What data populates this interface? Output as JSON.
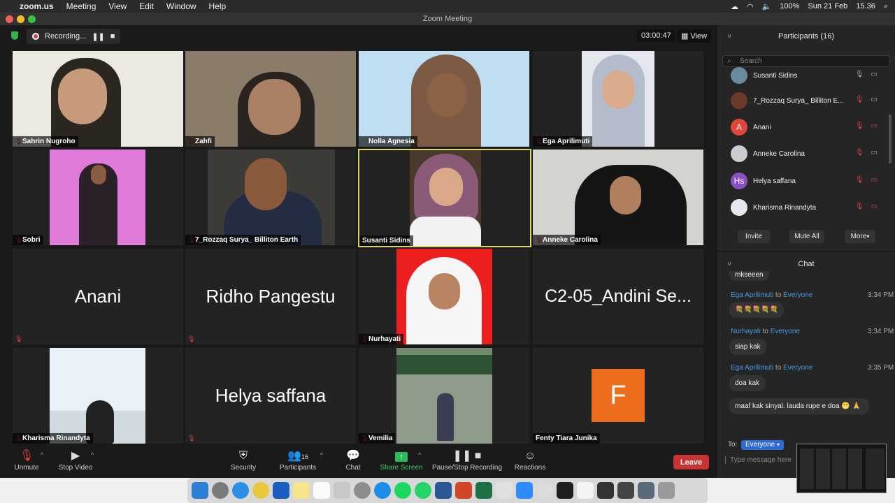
{
  "menubar": {
    "app": "zoom.us",
    "items": [
      "Meeting",
      "View",
      "Edit",
      "Window",
      "Help"
    ],
    "battery": "100%",
    "date": "Sun 21 Feb",
    "time": "15.36"
  },
  "window": {
    "title": "Zoom Meeting"
  },
  "recording": {
    "label": "Recording...",
    "timer": "03:00:47",
    "view": "View"
  },
  "tiles": [
    {
      "name": "Sahrin Nugroho"
    },
    {
      "name": "Zahfi"
    },
    {
      "name": "Nolla Agnesia"
    },
    {
      "name": "Ega Aprilimuti"
    },
    {
      "name": "Sobri"
    },
    {
      "name": "7_Rozzaq Surya_ Billiton Earth"
    },
    {
      "name": "Susanti Sidins"
    },
    {
      "name": "Anneke Carolina"
    },
    {
      "big": "Anani"
    },
    {
      "big": "Ridho Pangestu"
    },
    {
      "name": "Nurhayati"
    },
    {
      "big": "C2-05_Andini Se..."
    },
    {
      "name": "Kharisma Rinandyta"
    },
    {
      "big": "Helya saffana"
    },
    {
      "name": "Vemilia"
    },
    {
      "name": "Fenty Tiara Junika",
      "letter": "F"
    }
  ],
  "toolbar": {
    "unmute": "Unmute",
    "stop_video": "Stop Video",
    "security": "Security",
    "participants": "Participants",
    "participants_count": "16",
    "chat": "Chat",
    "share": "Share Screen",
    "record": "Pause/Stop Recording",
    "reactions": "Reactions",
    "leave": "Leave"
  },
  "participants": {
    "title": "Participants (16)",
    "search": "Search",
    "list": [
      {
        "name": "Susanti Sidins"
      },
      {
        "name": "7_Rozzaq Surya_ Billiton E..."
      },
      {
        "name": "Anani",
        "initial": "A"
      },
      {
        "name": "Anneke Carolina"
      },
      {
        "name": "Helya saffana",
        "initial": "Hs"
      },
      {
        "name": "Kharisma Rinandyta"
      }
    ],
    "invite": "Invite",
    "mute_all": "Mute All",
    "more": "More"
  },
  "chat": {
    "title": "Chat",
    "partial": "mkseeen",
    "m1": {
      "from": "Ega Aprilimuti",
      "to": "Everyone",
      "time": "3:34 PM",
      "text": "💐💐💐💐💐"
    },
    "m2": {
      "from": "Nurhayati",
      "to": "Everyone",
      "time": "3:34 PM",
      "text": "siap kak"
    },
    "m3": {
      "from": "Ega Aprilimuti",
      "to": "Everyone",
      "time": "3:35 PM",
      "text": "doa kak"
    },
    "m4": {
      "text": "maaf kak sinyal. lauda rupe e doa 😁 🙏"
    },
    "to_label": "To:",
    "to_value": "Everyone",
    "placeholder": "Type message here",
    "joiner": "to"
  }
}
